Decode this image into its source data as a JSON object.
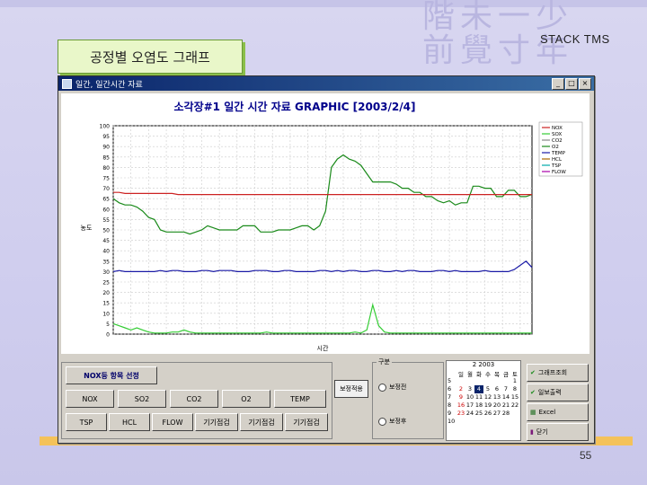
{
  "slide": {
    "title_label": "공정별 오염도 그래프",
    "stack_label": "STACK TMS",
    "page_number": "55",
    "decor_chars": [
      "階未一少",
      "前覺寸年"
    ]
  },
  "window": {
    "title": "일간, 일간시간 자료",
    "buttons": [
      "_",
      "□",
      "×"
    ]
  },
  "chart_data": {
    "type": "line",
    "title": "소각장#1 일간 시간 자료 GRAPHIC [2003/2/4]",
    "xlabel": "시간",
    "ylabel": "농도",
    "ylim": [
      0,
      100
    ],
    "yticks": [
      0,
      5,
      10,
      15,
      20,
      25,
      30,
      35,
      40,
      45,
      50,
      55,
      60,
      65,
      70,
      75,
      80,
      85,
      90,
      95,
      100
    ],
    "x_count": 72,
    "legend_position": "top-right",
    "legend": [
      "NOX",
      "SOX",
      "CO2",
      "O2",
      "TEMP",
      "HCL",
      "TSP",
      "FLOW"
    ],
    "series": [
      {
        "name": "O2",
        "color": "#1a8a1a",
        "values": [
          65,
          63,
          62,
          62,
          61,
          59,
          56,
          55,
          50,
          49,
          49,
          49,
          49,
          48,
          49,
          50,
          52,
          51,
          50,
          50,
          50,
          50,
          52,
          52,
          52,
          49,
          49,
          49,
          50,
          50,
          50,
          51,
          52,
          52,
          50,
          52,
          59,
          80,
          84,
          86,
          84,
          83,
          81,
          77,
          73,
          73,
          73,
          73,
          72,
          70,
          70,
          68,
          68,
          66,
          66,
          64,
          63,
          64,
          62,
          63,
          63,
          71,
          71,
          70,
          70,
          66,
          66,
          69,
          69,
          66,
          66,
          67
        ]
      },
      {
        "name": "NOX",
        "color": "#cc2222",
        "values": [
          68,
          68,
          67.5,
          67.5,
          67.5,
          67.5,
          67.5,
          67.5,
          67.5,
          67.5,
          67.5,
          67,
          67,
          67,
          67,
          67,
          67,
          67,
          67,
          67,
          67,
          67,
          67,
          67,
          67,
          67,
          67,
          67,
          67,
          67,
          67,
          67,
          67,
          67,
          67,
          67,
          67,
          67,
          67,
          67,
          67,
          67,
          67,
          67,
          67,
          67,
          67,
          67,
          67,
          67,
          67,
          67,
          67,
          67,
          67,
          67,
          67,
          67,
          67,
          67,
          67,
          67,
          67,
          67,
          67,
          67,
          67,
          67,
          67,
          67,
          67,
          67
        ]
      },
      {
        "name": "TEMP",
        "color": "#1a1aa6",
        "values": [
          30,
          30.5,
          30,
          30,
          30,
          30,
          30,
          30,
          30.5,
          30,
          30.5,
          30.5,
          30,
          30,
          30,
          30.5,
          30.5,
          30,
          30.5,
          30.5,
          30.5,
          30,
          30,
          30,
          30.5,
          30.5,
          30.5,
          30,
          30,
          30.5,
          30.5,
          30,
          30,
          30,
          30,
          30.5,
          30.5,
          30,
          30.5,
          30,
          30.5,
          30.5,
          30,
          30,
          30.5,
          30.5,
          30,
          30,
          30.5,
          30,
          30.5,
          30.5,
          30,
          30,
          30,
          30.5,
          30.5,
          30,
          30.5,
          30,
          30,
          30,
          30,
          30.5,
          30,
          30,
          30,
          30,
          31,
          33,
          35,
          32
        ]
      },
      {
        "name": "SOX",
        "color": "#33cc33",
        "values": [
          5,
          4,
          3,
          2,
          3,
          2,
          1,
          0.5,
          0.5,
          0.5,
          1,
          1,
          2,
          1,
          0.5,
          0.5,
          0.5,
          0.5,
          0.5,
          0.5,
          0.5,
          0.5,
          0.5,
          0.5,
          0.5,
          0.5,
          1,
          0.5,
          0.5,
          0.5,
          0.5,
          0.5,
          0.5,
          0.5,
          0.5,
          0.5,
          0.5,
          0.5,
          0.5,
          0.5,
          0.5,
          1,
          0.5,
          2,
          14,
          4,
          1,
          0.5,
          0.5,
          0.5,
          0.5,
          0.5,
          0.5,
          0.5,
          0.5,
          0.5,
          0.5,
          0.5,
          0.5,
          0.5,
          0.5,
          0.5,
          0.5,
          0.5,
          0.5,
          0.5,
          0.5,
          0.5,
          0.5,
          0.5,
          0.5,
          0.5
        ]
      }
    ]
  },
  "controls": {
    "group_title": "NOX등 항목 선정",
    "row1": [
      "NOX",
      "SO2",
      "CO2",
      "O2",
      "TEMP"
    ],
    "row2": [
      "TSP",
      "HCL",
      "FLOW",
      "기기점검",
      "기기점검",
      "기기점검"
    ],
    "toggle": "보정적용",
    "radio_group_label": "구분",
    "radio1": "보정전",
    "radio2": "보정후",
    "calendar": {
      "title": "2 2003",
      "days_header": [
        "일",
        "월",
        "화",
        "수",
        "목",
        "금",
        "토"
      ],
      "weeks": [
        "5",
        "6",
        "7",
        "8",
        "9",
        "10"
      ],
      "cells": [
        "",
        "",
        "",
        "",
        "",
        "",
        "1",
        "2",
        "3",
        "4",
        "5",
        "6",
        "7",
        "8",
        "9",
        "10",
        "11",
        "12",
        "13",
        "14",
        "15",
        "16",
        "17",
        "18",
        "19",
        "20",
        "21",
        "22",
        "23",
        "24",
        "25",
        "26",
        "27",
        "28",
        ""
      ]
    },
    "side_buttons": [
      "그래프조회",
      "일보출력",
      "Excel",
      "닫기"
    ]
  }
}
